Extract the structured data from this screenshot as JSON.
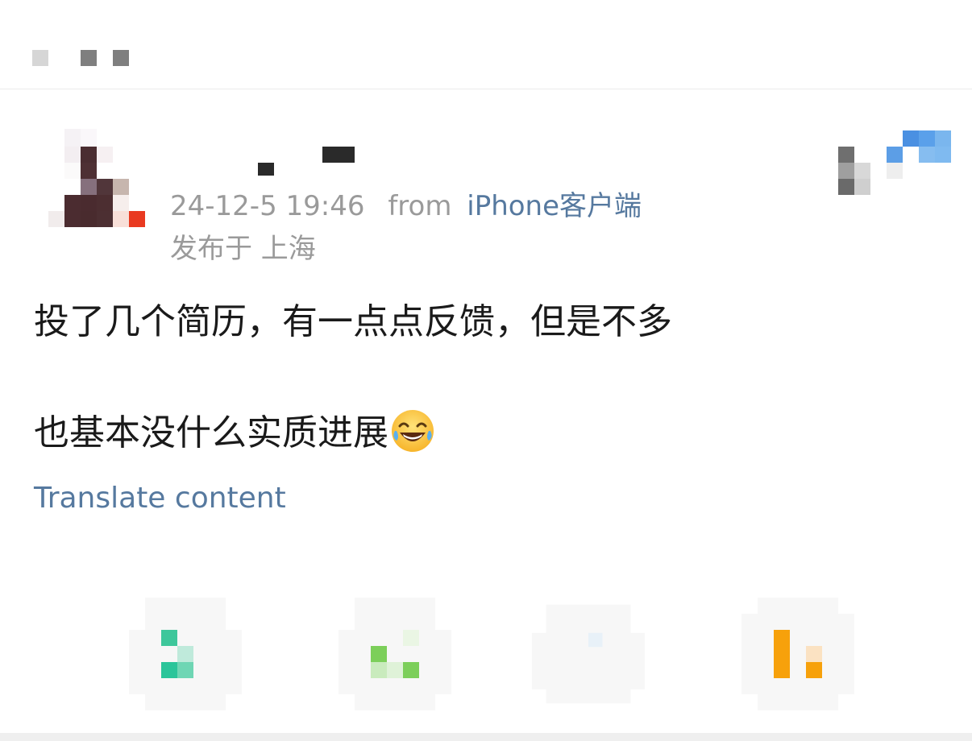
{
  "top_bar": {
    "back_icon": "back-arrow-icon",
    "menu_icon": "more-dots-icon"
  },
  "post": {
    "author_avatar": "avatar",
    "timestamp": "24-12-5 19:46",
    "from_label": "from",
    "source_label": "iPhone客户端",
    "location_label": "发布于 上海",
    "text_line_1": "投了几个简历，有一点点反馈，但是不多",
    "text_line_2": "也基本没什么实质进展",
    "emoji": "laughing-tears-emoji",
    "translate_label": "Translate content"
  },
  "actions": [
    {
      "name": "share",
      "icon": "share-icon",
      "color": "#2bc59a"
    },
    {
      "name": "comment",
      "icon": "comment-icon",
      "color": "#7ccf5a"
    },
    {
      "name": "repost",
      "icon": "repost-icon",
      "color": "#cfe3f2"
    },
    {
      "name": "like",
      "icon": "like-icon",
      "color": "#f7a10b"
    }
  ],
  "colors": {
    "link": "#56799f",
    "meta": "#9a9a9a",
    "text": "#1a1a1a"
  }
}
